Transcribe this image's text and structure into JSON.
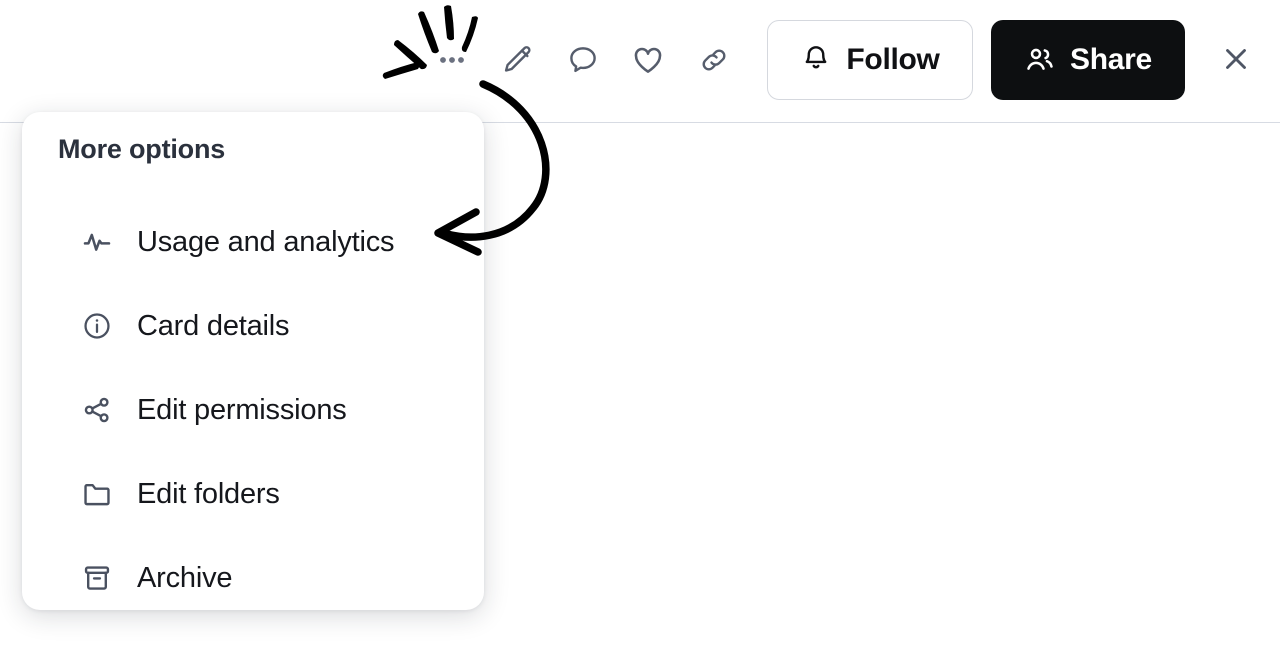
{
  "toolbar": {
    "icon_buttons": [
      {
        "name": "more-options-icon",
        "label": "More options"
      },
      {
        "name": "edit-icon",
        "label": "Edit"
      },
      {
        "name": "comment-icon",
        "label": "Comment"
      },
      {
        "name": "like-icon",
        "label": "Like"
      },
      {
        "name": "link-icon",
        "label": "Copy link"
      }
    ],
    "follow": {
      "label": "Follow",
      "icon": "bell-icon",
      "background": "#ffffff",
      "border_color": "#d5d8de",
      "text_color": "#101114"
    },
    "share": {
      "label": "Share",
      "icon": "people-icon",
      "background": "#0d0f11",
      "text_color": "#ffffff"
    },
    "close": {
      "label": "Close",
      "icon": "close-icon"
    },
    "divider_color": "#d7dbe3"
  },
  "menu": {
    "title": "More options",
    "title_color": "#2b313d",
    "background": "#ffffff",
    "items": [
      {
        "label": "Usage and analytics",
        "icon": "activity-pulse-icon"
      },
      {
        "label": "Card details",
        "icon": "info-circle-icon"
      },
      {
        "label": "Edit permissions",
        "icon": "share-nodes-icon"
      },
      {
        "label": "Edit folders",
        "icon": "folder-icon"
      },
      {
        "label": "Archive",
        "icon": "archive-box-icon"
      }
    ],
    "icon_color": "#4a5160",
    "label_color": "#15171c"
  },
  "annotations": {
    "click_burst": {
      "name": "click-burst-marks",
      "target": "More options",
      "color": "#000000"
    },
    "curved_arrow": {
      "name": "curved-arrow",
      "points_to": "Usage and analytics",
      "color": "#000000"
    }
  }
}
